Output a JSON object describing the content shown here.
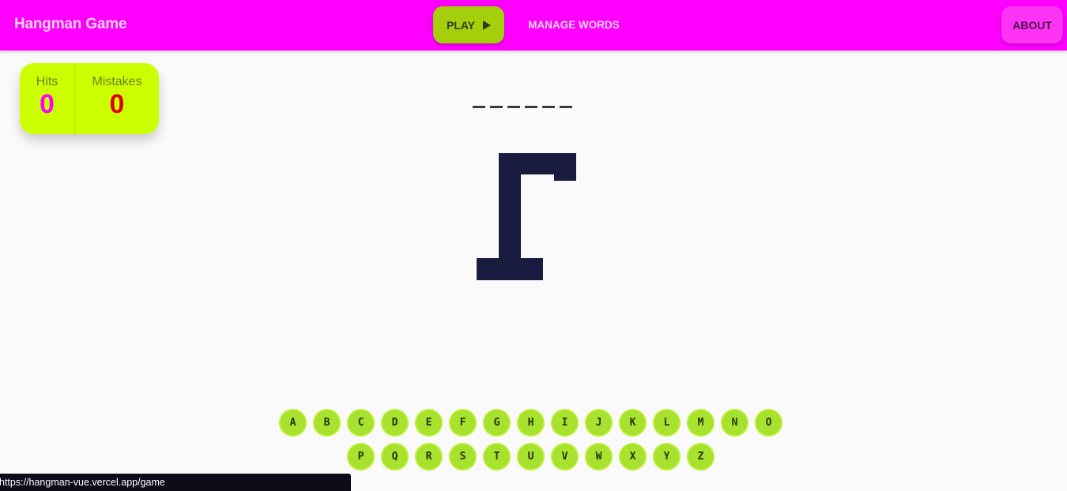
{
  "header": {
    "title": "Hangman Game",
    "play_label": "PLAY",
    "manage_label": "MANAGE WORDS",
    "about_label": "ABOUT"
  },
  "score": {
    "hits_label": "Hits",
    "hits_value": "0",
    "mistakes_label": "Mistakes",
    "mistakes_value": "0"
  },
  "word": {
    "revealed": [
      "",
      "",
      "",
      "",
      "",
      ""
    ]
  },
  "keyboard": {
    "row1": [
      "A",
      "B",
      "C",
      "D",
      "E",
      "F",
      "G",
      "H",
      "I",
      "J",
      "K",
      "L",
      "M",
      "N",
      "O"
    ],
    "row2": [
      "P",
      "Q",
      "R",
      "S",
      "T",
      "U",
      "V",
      "W",
      "X",
      "Y",
      "Z"
    ]
  },
  "status_bar": {
    "url": "https://hangman-vue.vercel.app/game"
  },
  "colors": {
    "header_bg": "#ff00ff",
    "play_bg": "#a4cf0a",
    "about_bg": "#ff33f6",
    "score_bg": "#ccff00",
    "key_bg": "#a6e22e",
    "gallows": "#191b3f"
  },
  "icons": {
    "play": "play-icon"
  }
}
